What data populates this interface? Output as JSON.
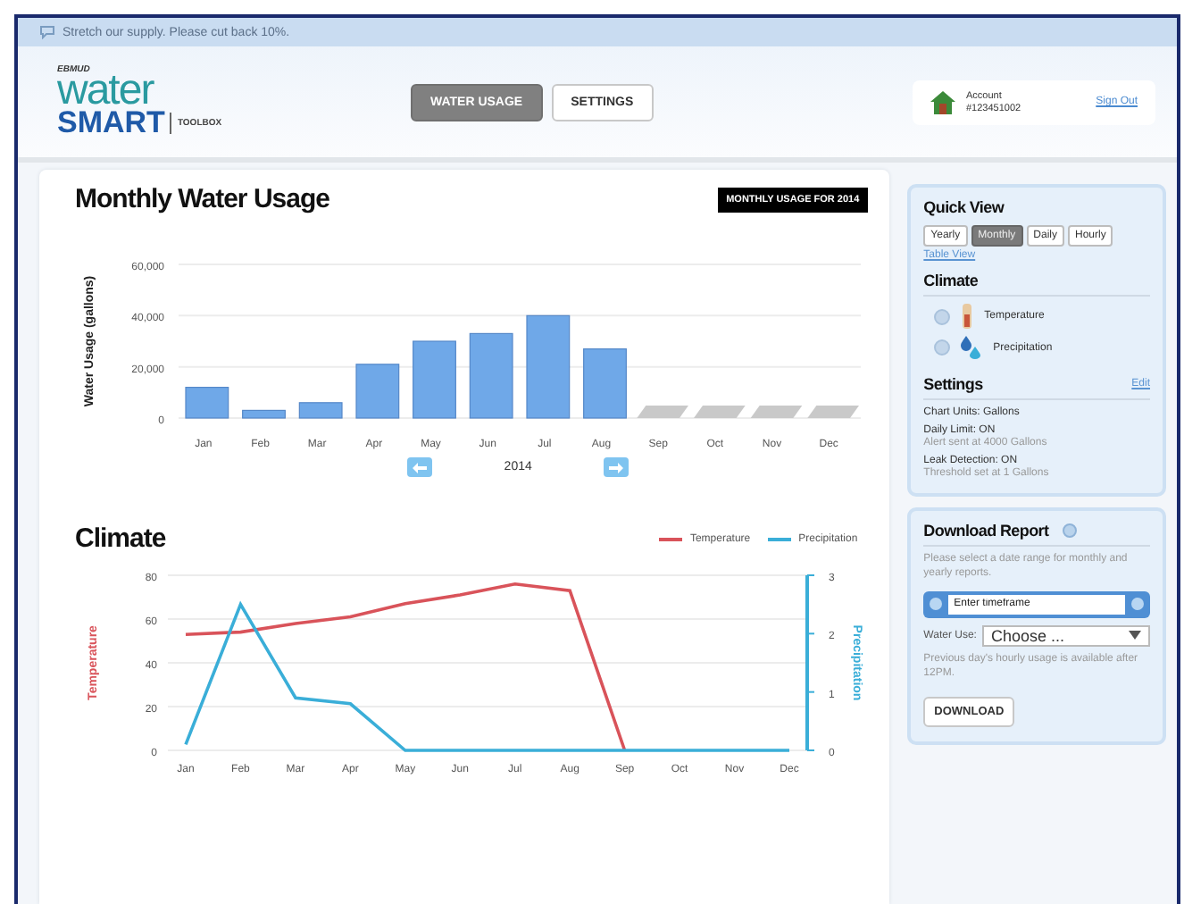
{
  "banner": {
    "text": "Stretch our supply. Please cut back 10%."
  },
  "logo": {
    "mark": "EBMUD",
    "word1": "water",
    "word2": "SMART",
    "word3": "TOOLBOX"
  },
  "tabs": [
    {
      "label": "WATER USAGE",
      "selected": true
    },
    {
      "label": "SETTINGS",
      "selected": false
    }
  ],
  "account": {
    "label": "Account",
    "number": "#123451002",
    "sign_out": "Sign Out"
  },
  "usage": {
    "title": "Monthly Water Usage",
    "badge": "MONTHLY USAGE FOR 2014",
    "year": "2014",
    "chart_data": {
      "type": "bar",
      "ylabel": "Water Usage (gallons)",
      "categories": [
        "Jan",
        "Feb",
        "Mar",
        "Apr",
        "May",
        "Jun",
        "Jul",
        "Aug",
        "Sep",
        "Oct",
        "Nov",
        "Dec"
      ],
      "values": [
        12000,
        3000,
        6000,
        21000,
        30000,
        33000,
        40000,
        27000,
        null,
        null,
        null,
        null
      ],
      "ylim": [
        0,
        60000
      ],
      "yticks": [
        {
          "value": 0,
          "label": "0"
        },
        {
          "value": 20000,
          "label": "20,000"
        },
        {
          "value": 40000,
          "label": "40,000"
        },
        {
          "value": 60000,
          "label": "60,000"
        }
      ]
    }
  },
  "climate": {
    "title": "Climate",
    "chart_data": {
      "type": "line",
      "ylabel": "Temperature",
      "y2label": "Precipitation",
      "categories": [
        "Jan",
        "Feb",
        "Mar",
        "Apr",
        "May",
        "Jun",
        "Jul",
        "Aug",
        "Sep",
        "Oct",
        "Nov",
        "Dec"
      ],
      "series": [
        {
          "name": "Temperature",
          "color": "#d9535a",
          "values": [
            53,
            54,
            58,
            61,
            67,
            71,
            76,
            73,
            0,
            null,
            null,
            null
          ]
        },
        {
          "name": "Precipitation",
          "color": "#3aaed8",
          "axis": "y2",
          "values": [
            0.1,
            2.5,
            0.9,
            0.8,
            0,
            0,
            0,
            0,
            0,
            0,
            0,
            0
          ]
        }
      ],
      "grid": true,
      "ylim": [
        0,
        80
      ],
      "yticks": [
        0,
        20,
        40,
        60,
        80
      ],
      "y2lim": [
        0,
        3
      ],
      "y2ticks": [
        0,
        1,
        2,
        3
      ]
    }
  },
  "quick_view": {
    "title": "Quick View",
    "periods": [
      {
        "label": "Yearly",
        "selected": false
      },
      {
        "label": "Monthly",
        "selected": true
      },
      {
        "label": "Daily",
        "selected": false
      },
      {
        "label": "Hourly",
        "selected": false
      }
    ],
    "table_link": "Table View"
  },
  "climate_toggles": {
    "title": "Climate",
    "items": [
      {
        "kind": "temperature",
        "label": "Temperature",
        "selected": false
      },
      {
        "kind": "precipitation",
        "label": "Precipitation",
        "selected": false
      }
    ]
  },
  "settings": {
    "title": "Settings",
    "edit": "Edit",
    "lines": [
      {
        "kind": "main",
        "text": "Chart Units: Gallons"
      },
      {
        "kind": "main",
        "text": "Daily Limit: ON"
      },
      {
        "kind": "note",
        "text": "Alert sent at 4000 Gallons"
      },
      {
        "kind": "main",
        "text": "Leak Detection: ON"
      },
      {
        "kind": "note",
        "text": "Threshold set at 1 Gallons"
      }
    ]
  },
  "download": {
    "title": "Download Report",
    "hint": "Please select a date range for monthly and yearly reports.",
    "timeframe_placeholder": "Enter timeframe",
    "water_use_label": "Water Use:",
    "water_use_value": "Choose ...",
    "note": "Previous day's hourly usage is available after 12PM.",
    "button": "DOWNLOAD"
  }
}
